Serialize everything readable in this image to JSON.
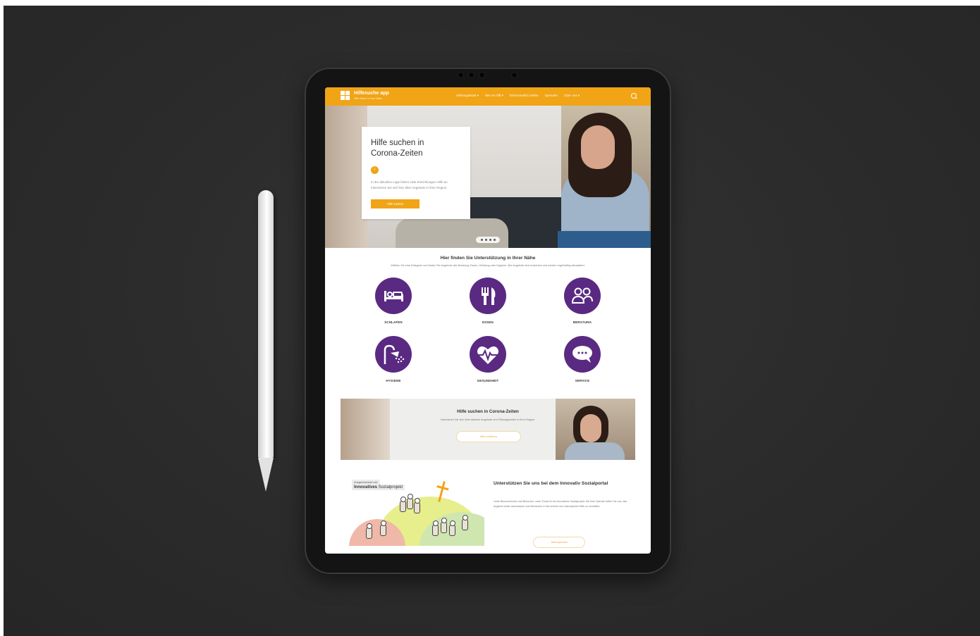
{
  "header": {
    "logo_title": "Hilfesuche app",
    "logo_subtitle": "Hilfe finden in Ihrer Nähe",
    "menu": [
      "Hilfeangebote ▾",
      "Wie es hilft ▾",
      "Ehrenamtlich helfen",
      "Spenden",
      "Über uns ▾"
    ]
  },
  "hero": {
    "title": "Hilfe suchen in Corona-Zeiten",
    "badge": "i",
    "text": "In der aktuellen Lage bieten viele Einrichtungen Hilfe an. Informieren Sie sich hier über Angebote in Ihrer Region.",
    "button": "Hilfe suchen"
  },
  "finder": {
    "title": "Hier finden Sie Unterstützung in Ihrer Nähe",
    "text": "Wählen Sie eine Kategorie und finden Sie Angebote wie Beratung, Essen, Kleidung oder Hygiene. Alle Angebote sind kostenlos und werden regelmäßig aktualisiert."
  },
  "categories": [
    {
      "label": "SCHLAFEN",
      "icon": "bed-icon"
    },
    {
      "label": "ESSEN",
      "icon": "cutlery-icon"
    },
    {
      "label": "BERATUNG",
      "icon": "people-icon"
    },
    {
      "label": "HYGIENE",
      "icon": "shower-icon"
    },
    {
      "label": "GESUNDHEIT",
      "icon": "heart-pulse-icon"
    },
    {
      "label": "SERVICE",
      "icon": "chat-icon"
    }
  ],
  "banner": {
    "title": "Hilfe suchen in Corona-Zeiten",
    "text": "Informieren Sie sich über aktuelle Angebote und Öffnungszeiten in Ihrer Region.",
    "button": "Mehr erfahren"
  },
  "illustration": {
    "tag1": "Ausgezeichnet mit:",
    "tag2_bold": "Innovatives",
    "tag2_rest": " Sozialprojekt"
  },
  "support": {
    "title": "Unterstützen Sie uns bei dem Innovativ Sozialportal",
    "text": "Liebe Besucherinnen und Besucher, unser Portal ist ein innovatives Sozialprojekt. Mit Ihrer Spende helfen Sie uns, das Angebot weiter auszubauen und Menschen in Not schnell und unkompliziert Hilfe zu vermitteln.",
    "button": "Jetzt spenden"
  },
  "colors": {
    "accent": "#f0a416",
    "purple": "#5a2a82"
  }
}
